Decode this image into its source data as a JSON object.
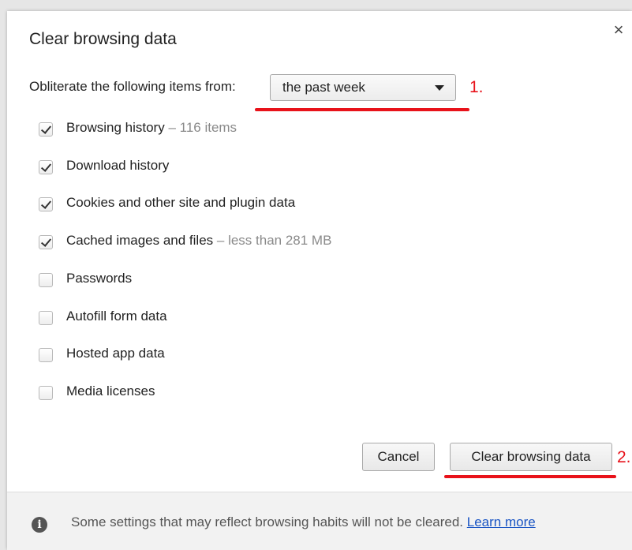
{
  "dialog": {
    "title": "Clear browsing data",
    "close_glyph": "×"
  },
  "period": {
    "label": "Obliterate the following items from:",
    "selected": "the past week"
  },
  "annotations": {
    "mark_1": "1.",
    "mark_2": "2.",
    "color": "#e8121a"
  },
  "items": [
    {
      "label": "Browsing history",
      "extra": " – 116 items",
      "checked": true
    },
    {
      "label": "Download history",
      "extra": "",
      "checked": true
    },
    {
      "label": "Cookies and other site and plugin data",
      "extra": "",
      "checked": true
    },
    {
      "label": "Cached images and files",
      "extra": " – less than 281 MB",
      "checked": true
    },
    {
      "label": "Passwords",
      "extra": "",
      "checked": false
    },
    {
      "label": "Autofill form data",
      "extra": "",
      "checked": false
    },
    {
      "label": "Hosted app data",
      "extra": "",
      "checked": false
    },
    {
      "label": "Media licenses",
      "extra": "",
      "checked": false
    }
  ],
  "buttons": {
    "cancel": "Cancel",
    "clear": "Clear browsing data"
  },
  "footer": {
    "icon": "info-icon",
    "text": "Some settings that may reflect browsing habits will not be cleared. ",
    "link": "Learn more"
  }
}
